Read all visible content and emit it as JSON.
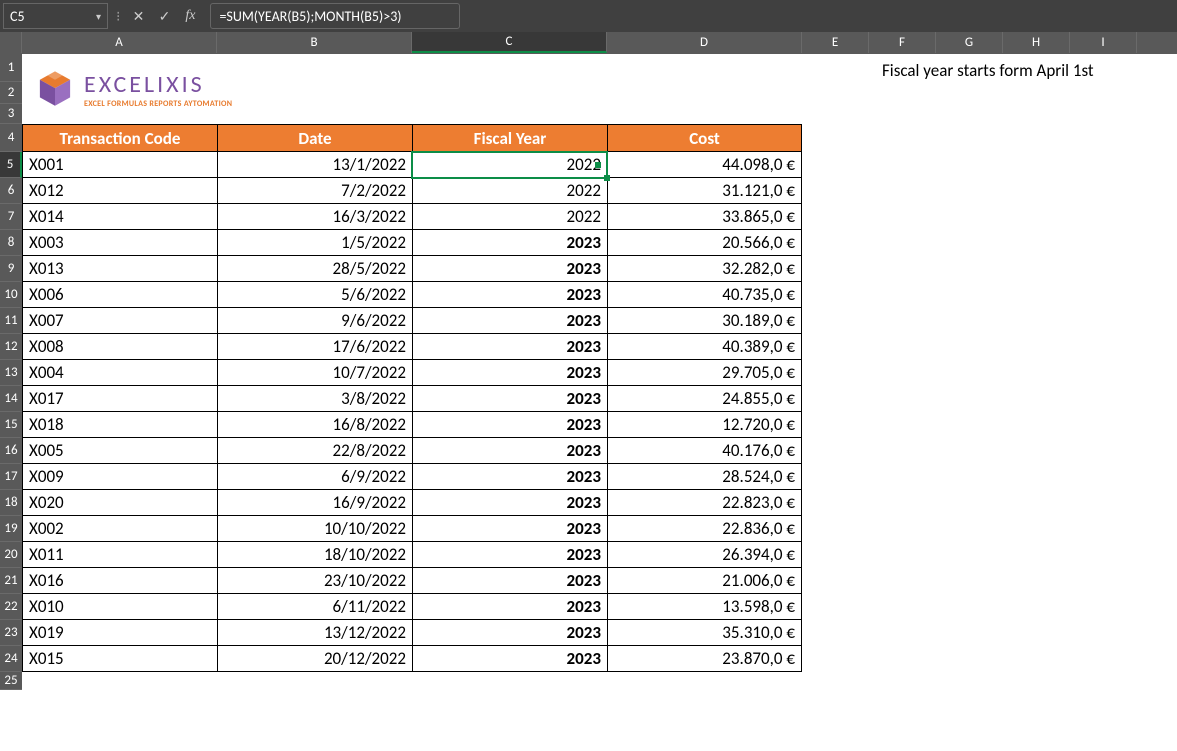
{
  "namebox": "C5",
  "formula": "=SUM(YEAR(B5);MONTH(B5)>3)",
  "columns": [
    "A",
    "B",
    "C",
    "D",
    "E",
    "F",
    "G",
    "H",
    "I"
  ],
  "active_col": "C",
  "row_labels": [
    "1",
    "2",
    "3",
    "4",
    "5",
    "6",
    "7",
    "8",
    "9",
    "10",
    "11",
    "12",
    "13",
    "14",
    "15",
    "16",
    "17",
    "18",
    "19",
    "20",
    "21",
    "22",
    "23",
    "24",
    "25"
  ],
  "active_row": "5",
  "logo": {
    "title": "EXCELIXIS",
    "sub": "EXCEL FORMULAS REPORTS AYTOMATION"
  },
  "headers": {
    "code": "Transaction Code",
    "date": "Date",
    "fy": "Fiscal Year",
    "cost": "Cost"
  },
  "note": "Fiscal year starts form April 1st",
  "rows": [
    {
      "code": "X001",
      "date": "13/1/2022",
      "fy": "2022",
      "cost": "44.098,0 €",
      "bold": false
    },
    {
      "code": "X012",
      "date": "7/2/2022",
      "fy": "2022",
      "cost": "31.121,0 €",
      "bold": false
    },
    {
      "code": "X014",
      "date": "16/3/2022",
      "fy": "2022",
      "cost": "33.865,0 €",
      "bold": false
    },
    {
      "code": "X003",
      "date": "1/5/2022",
      "fy": "2023",
      "cost": "20.566,0 €",
      "bold": true
    },
    {
      "code": "X013",
      "date": "28/5/2022",
      "fy": "2023",
      "cost": "32.282,0 €",
      "bold": true
    },
    {
      "code": "X006",
      "date": "5/6/2022",
      "fy": "2023",
      "cost": "40.735,0 €",
      "bold": true
    },
    {
      "code": "X007",
      "date": "9/6/2022",
      "fy": "2023",
      "cost": "30.189,0 €",
      "bold": true
    },
    {
      "code": "X008",
      "date": "17/6/2022",
      "fy": "2023",
      "cost": "40.389,0 €",
      "bold": true
    },
    {
      "code": "X004",
      "date": "10/7/2022",
      "fy": "2023",
      "cost": "29.705,0 €",
      "bold": true
    },
    {
      "code": "X017",
      "date": "3/8/2022",
      "fy": "2023",
      "cost": "24.855,0 €",
      "bold": true
    },
    {
      "code": "X018",
      "date": "16/8/2022",
      "fy": "2023",
      "cost": "12.720,0 €",
      "bold": true
    },
    {
      "code": "X005",
      "date": "22/8/2022",
      "fy": "2023",
      "cost": "40.176,0 €",
      "bold": true
    },
    {
      "code": "X009",
      "date": "6/9/2022",
      "fy": "2023",
      "cost": "28.524,0 €",
      "bold": true
    },
    {
      "code": "X020",
      "date": "16/9/2022",
      "fy": "2023",
      "cost": "22.823,0 €",
      "bold": true
    },
    {
      "code": "X002",
      "date": "10/10/2022",
      "fy": "2023",
      "cost": "22.836,0 €",
      "bold": true
    },
    {
      "code": "X011",
      "date": "18/10/2022",
      "fy": "2023",
      "cost": "26.394,0 €",
      "bold": true
    },
    {
      "code": "X016",
      "date": "23/10/2022",
      "fy": "2023",
      "cost": "21.006,0 €",
      "bold": true
    },
    {
      "code": "X010",
      "date": "6/11/2022",
      "fy": "2023",
      "cost": "13.598,0 €",
      "bold": true
    },
    {
      "code": "X019",
      "date": "13/12/2022",
      "fy": "2023",
      "cost": "35.310,0 €",
      "bold": true
    },
    {
      "code": "X015",
      "date": "20/12/2022",
      "fy": "2023",
      "cost": "23.870,0 €",
      "bold": true
    }
  ],
  "row_heights": {
    "logo_total": 70,
    "r1": 28,
    "r2": 22,
    "r3": 20,
    "header": 28,
    "data": 26,
    "below": 18
  }
}
